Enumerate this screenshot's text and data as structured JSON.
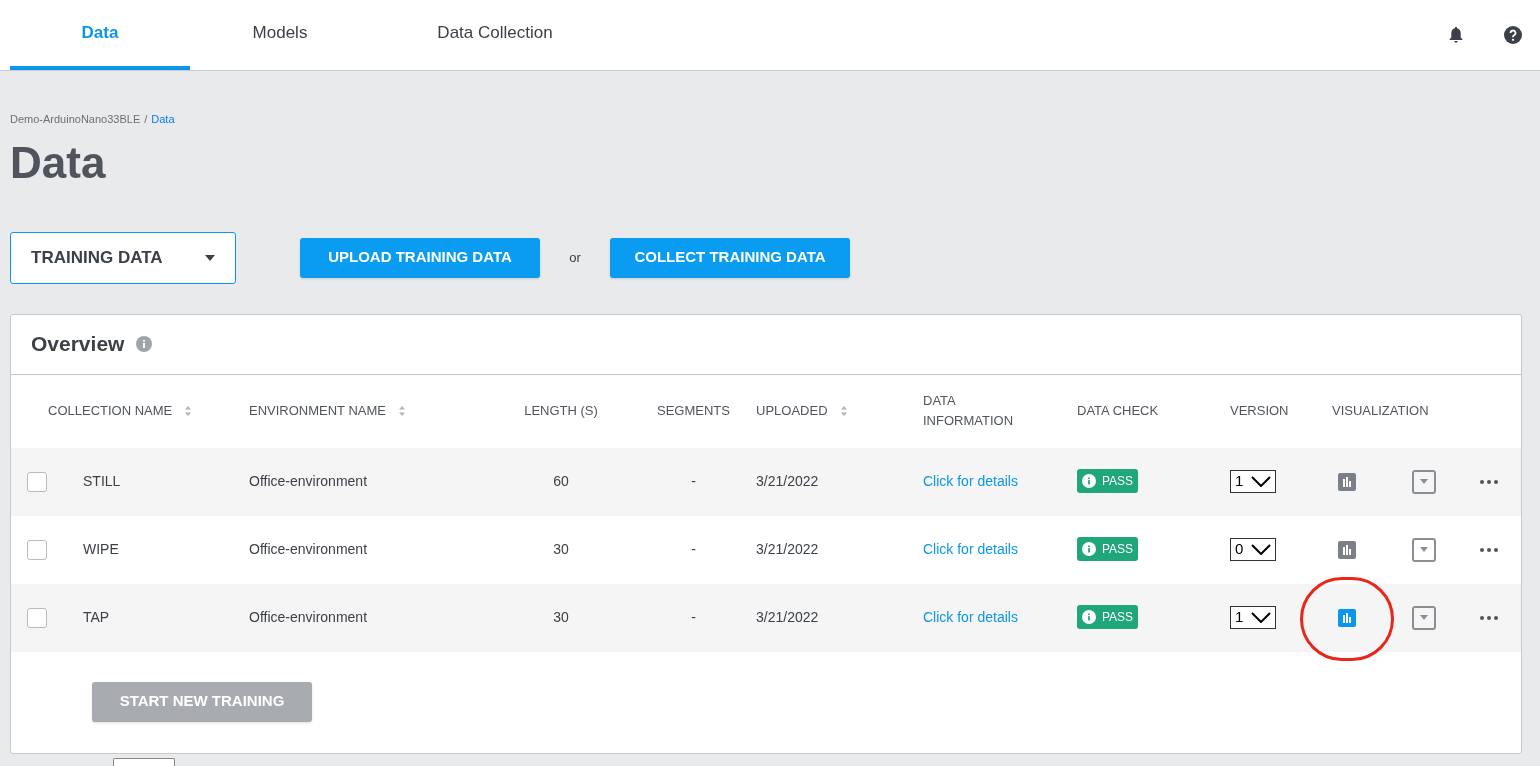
{
  "tabs": [
    {
      "label": "Data",
      "selected": true
    },
    {
      "label": "Models",
      "selected": false
    },
    {
      "label": "Data Collection",
      "selected": false
    }
  ],
  "breadcrumb": {
    "parent": "Demo-ArduinoNano33BLE",
    "separator": "/",
    "current": "Data"
  },
  "title": "Data",
  "data_select": {
    "value": "TRAINING DATA"
  },
  "actions": {
    "upload": "UPLOAD TRAINING DATA",
    "separator": "or",
    "collect": "COLLECT TRAINING DATA"
  },
  "overview": {
    "title": "Overview",
    "columns": [
      {
        "label": "COLLECTION NAME",
        "sortable": true
      },
      {
        "label": "ENVIRONMENT NAME",
        "sortable": true
      },
      {
        "label": "LENGTH (S)",
        "sortable": false
      },
      {
        "label": "SEGMENTS",
        "sortable": false
      },
      {
        "label": "UPLOADED",
        "sortable": true
      },
      {
        "label": "DATA INFORMATION",
        "sortable": false
      },
      {
        "label": "DATA CHECK",
        "sortable": false
      },
      {
        "label": "VERSION",
        "sortable": false
      },
      {
        "label": "VISUALIZATION",
        "sortable": false
      }
    ],
    "rows": [
      {
        "checked": false,
        "name": "STILL",
        "environment": "Office-environment",
        "length": "60",
        "segments": "-",
        "uploaded": "3/21/2022",
        "info": "Click for details",
        "check": "PASS",
        "version": "1",
        "viz_active": false,
        "annotated": false
      },
      {
        "checked": false,
        "name": "WIPE",
        "environment": "Office-environment",
        "length": "30",
        "segments": "-",
        "uploaded": "3/21/2022",
        "info": "Click for details",
        "check": "PASS",
        "version": "0",
        "viz_active": false,
        "annotated": false
      },
      {
        "checked": false,
        "name": "TAP",
        "environment": "Office-environment",
        "length": "30",
        "segments": "-",
        "uploaded": "3/21/2022",
        "info": "Click for details",
        "check": "PASS",
        "version": "1",
        "viz_active": true,
        "annotated": true
      }
    ],
    "start_button": {
      "label": "START NEW TRAINING",
      "disabled": true
    }
  }
}
